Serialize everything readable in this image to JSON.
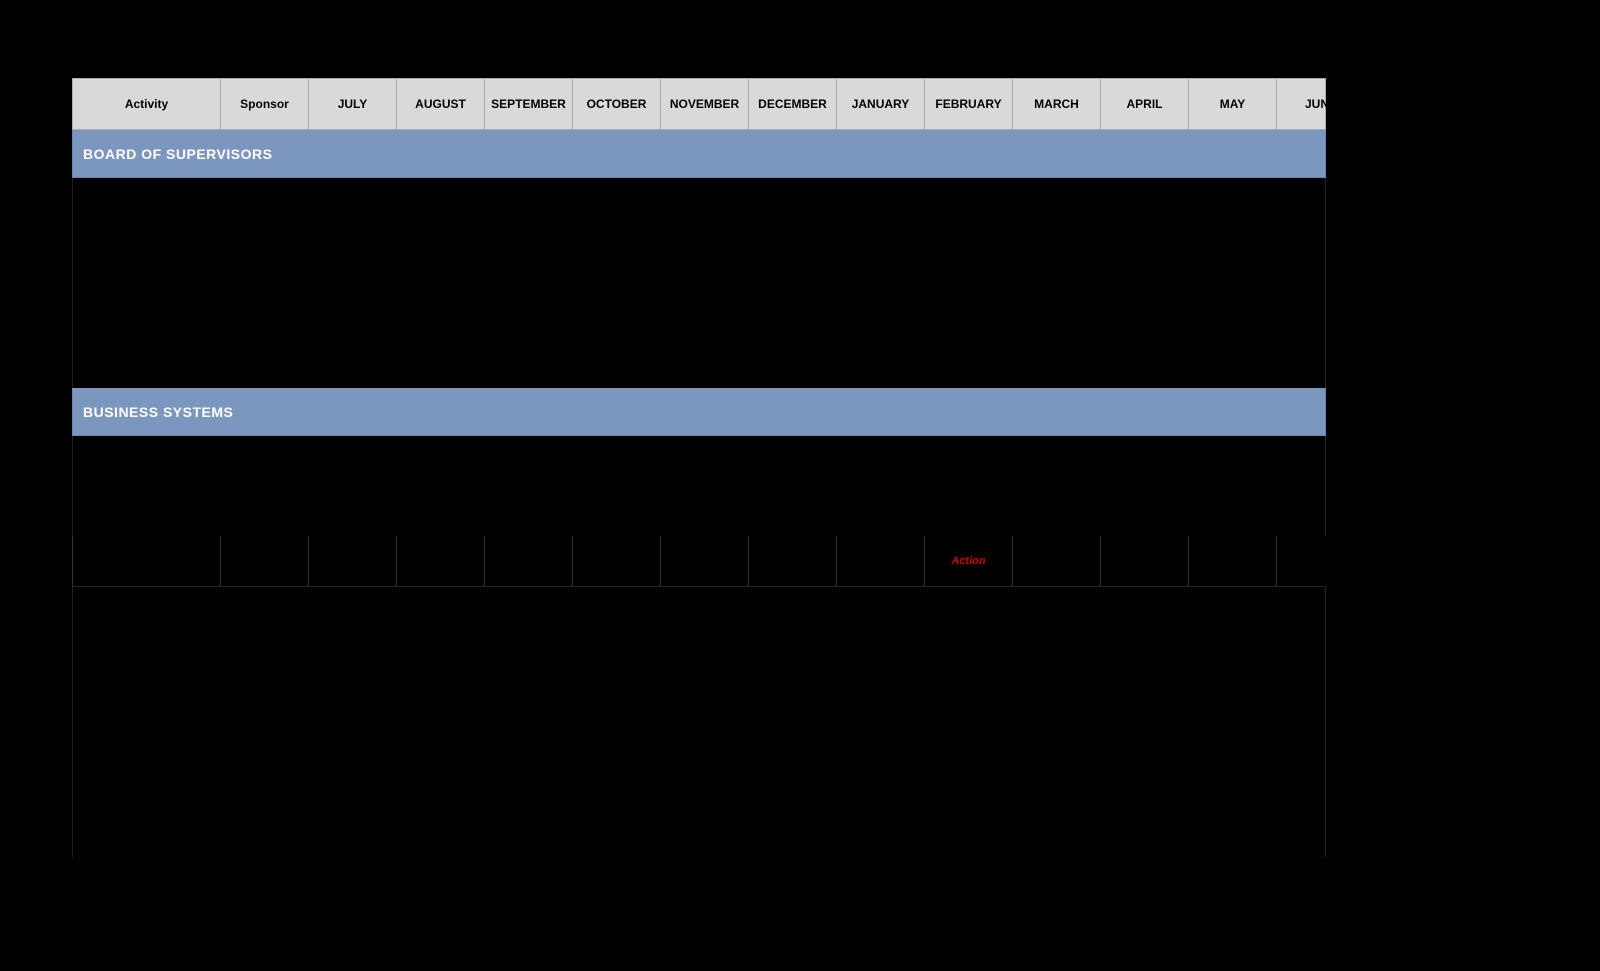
{
  "header": {
    "columns": [
      {
        "key": "activity",
        "label": "Activity"
      },
      {
        "key": "sponsor",
        "label": "Sponsor"
      },
      {
        "key": "july",
        "label": "JULY"
      },
      {
        "key": "august",
        "label": "AUGUST"
      },
      {
        "key": "september",
        "label": "SEPTEMBER"
      },
      {
        "key": "october",
        "label": "OCTOBER"
      },
      {
        "key": "november",
        "label": "NOVEMBER"
      },
      {
        "key": "december",
        "label": "DECEMBER"
      },
      {
        "key": "january",
        "label": "JANUARY"
      },
      {
        "key": "february",
        "label": "FEBRUARY"
      },
      {
        "key": "march",
        "label": "MARCH"
      },
      {
        "key": "april",
        "label": "APRIL"
      },
      {
        "key": "may",
        "label": "MAY"
      },
      {
        "key": "june",
        "label": "JUNE"
      }
    ]
  },
  "sections": [
    {
      "title": "BOARD OF SUPERVISORS",
      "rows": []
    },
    {
      "title": "BUSINESS SYSTEMS",
      "rows": [
        {
          "cells": [
            "",
            "",
            "",
            "",
            "",
            "",
            "",
            "",
            "",
            "Action",
            "",
            "",
            "",
            ""
          ]
        }
      ]
    }
  ],
  "action_label": "Action"
}
